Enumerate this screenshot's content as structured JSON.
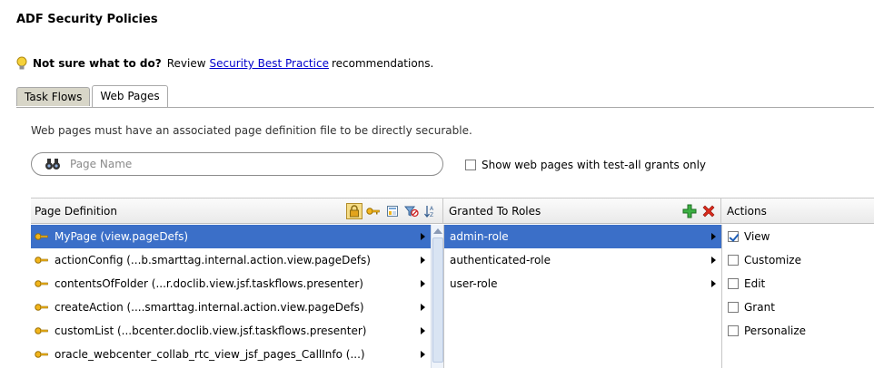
{
  "page": {
    "title": "ADF Security Policies",
    "hint_bold": "Not sure what to do?",
    "hint_text": "Review",
    "hint_link": "Security Best Practice",
    "hint_tail": "recommendations."
  },
  "tabs": [
    {
      "label": "Task Flows",
      "active": false
    },
    {
      "label": "Web Pages",
      "active": true
    }
  ],
  "note": "Web pages must have an associated page definition file to be directly securable.",
  "search": {
    "placeholder": "Page Name",
    "value": ""
  },
  "filter_checkbox": {
    "label": "Show web pages with test-all grants only",
    "checked": false
  },
  "columns": {
    "page_definition": "Page Definition",
    "granted_to_roles": "Granted To Roles",
    "actions": "Actions"
  },
  "toolbar_icons": [
    "lock-icon",
    "key-icon",
    "page-icon",
    "filter-icon",
    "sort-icon"
  ],
  "role_toolbar_icons": [
    "add-icon",
    "delete-icon"
  ],
  "page_definitions": [
    {
      "label": "MyPage (view.pageDefs)",
      "selected": true
    },
    {
      "label": "actionConfig (...b.smarttag.internal.action.view.pageDefs)",
      "selected": false
    },
    {
      "label": "contentsOfFolder (...r.doclib.view.jsf.taskflows.presenter)",
      "selected": false
    },
    {
      "label": "createAction (....smarttag.internal.action.view.pageDefs)",
      "selected": false
    },
    {
      "label": "customList (...bcenter.doclib.view.jsf.taskflows.presenter)",
      "selected": false
    },
    {
      "label": "oracle_webcenter_collab_rtc_view_jsf_pages_CallInfo (...)",
      "selected": false
    }
  ],
  "roles": [
    {
      "label": "admin-role",
      "selected": true
    },
    {
      "label": "authenticated-role",
      "selected": false
    },
    {
      "label": "user-role",
      "selected": false
    }
  ],
  "actions": [
    {
      "label": "View",
      "checked": true
    },
    {
      "label": "Customize",
      "checked": false
    },
    {
      "label": "Edit",
      "checked": false
    },
    {
      "label": "Grant",
      "checked": false
    },
    {
      "label": "Personalize",
      "checked": false
    }
  ],
  "colors": {
    "selection": "#3b6fc8",
    "link": "#0000cc"
  }
}
